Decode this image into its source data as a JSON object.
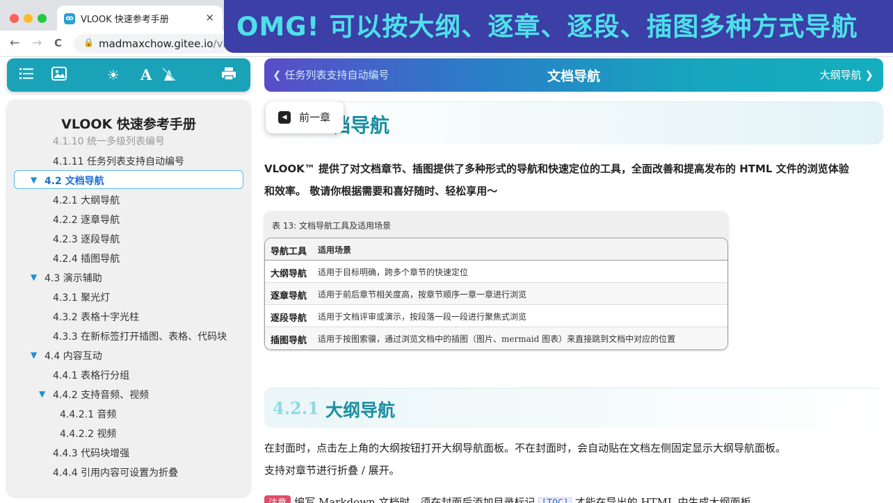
{
  "browser": {
    "tab_title": "VLOOK 快速参考手册",
    "tab_favicon": "ꝏ",
    "url_main": "madmaxchow.gitee.io",
    "url_rest": "/vlook/",
    "nav": {
      "back": "←",
      "forward": "→",
      "reload": "C",
      "close": "×"
    }
  },
  "banner": {
    "text": "OMG! 可以按大纲、逐章、逐段、插图多种方式导航",
    "bg": "#3b3fa6",
    "fg": "#4ee0e9"
  },
  "toolbar": {
    "outline_icon": "outline-list-icon",
    "gallery_icon": "figure-gallery-icon",
    "theme_icon": "sun-icon",
    "font_icon": "font-icon",
    "spotlight_icon": "laser-icon",
    "print_icon": "printer-icon",
    "accent": "#1aa3b8"
  },
  "outline": {
    "title": "VLOOK 快速参考手册",
    "items": [
      {
        "num": "4.1.10",
        "label": "统一多级列表编号"
      },
      {
        "num": "4.1.11",
        "label": "任务列表支持自动编号"
      },
      {
        "num": "4.2",
        "label": "文档导航"
      },
      {
        "num": "4.2.1",
        "label": "大纲导航"
      },
      {
        "num": "4.2.2",
        "label": "逐章导航"
      },
      {
        "num": "4.2.3",
        "label": "逐段导航"
      },
      {
        "num": "4.2.4",
        "label": "插图导航"
      },
      {
        "num": "4.3",
        "label": "演示辅助"
      },
      {
        "num": "4.3.1",
        "label": "聚光灯"
      },
      {
        "num": "4.3.2",
        "label": "表格十字光柱"
      },
      {
        "num": "4.3.3",
        "label": "在新标签打开插图、表格、代码块"
      },
      {
        "num": "4.4",
        "label": "内容互动"
      },
      {
        "num": "4.4.1",
        "label": "表格行分组"
      },
      {
        "num": "4.4.2",
        "label": "支持音频、视频"
      },
      {
        "num": "4.4.2.1",
        "label": "音频"
      },
      {
        "num": "4.4.2.2",
        "label": "视频"
      },
      {
        "num": "4.4.3",
        "label": "代码块增强"
      },
      {
        "num": "4.4.4",
        "label": "引用内容可设置为折叠"
      }
    ]
  },
  "chapter_nav": {
    "prev": "任务列表支持自动编号",
    "current": "文档导航",
    "next": "大纲导航"
  },
  "prev_chapter_button": "前一章",
  "section": {
    "heading_tail": "档导航",
    "intro_line1": "VLOOK™ 提供了对文档章节、插图提供了多种形式的导航和快速定位的工具，全面改善和提高发布的 HTML 文件的浏览体验",
    "intro_line2": "和效率。 敬请你根据需要和喜好随时、轻松享用～"
  },
  "table": {
    "caption": "表 13: 文档导航工具及适用场景",
    "headers": [
      "导航工具",
      "适用场景"
    ],
    "rows": [
      [
        "大纲导航",
        "适用于目标明确，跨多个章节的快速定位"
      ],
      [
        "逐章导航",
        "适用于前后章节相关度高，按章节顺序一章一章进行浏览"
      ],
      [
        "逐段导航",
        "适用于文档评审或演示，按段落一段一段进行聚焦式浏览"
      ],
      [
        "插图导航",
        "适用于按图索骥，通过浏览文档中的插图（图片、mermaid 图表）来直接跳到文档中对应的位置"
      ]
    ]
  },
  "subsection": {
    "num": "4.2.1",
    "title": "大纲导航",
    "p1": "在封面时，点击左上角的大纲按钮打开大纲导航面板。不在封面时，会自动贴在文档左侧固定显示大纲导航面板。",
    "p2": "支持对章节进行折叠 / 展开。",
    "note_tag": "注意",
    "note_text": "编写 Markdown 文档时，须在封面后添加目录标记",
    "note_code": "[TOC]",
    "note_after": "才能在导出的 HTML 中生成大纲面板"
  }
}
